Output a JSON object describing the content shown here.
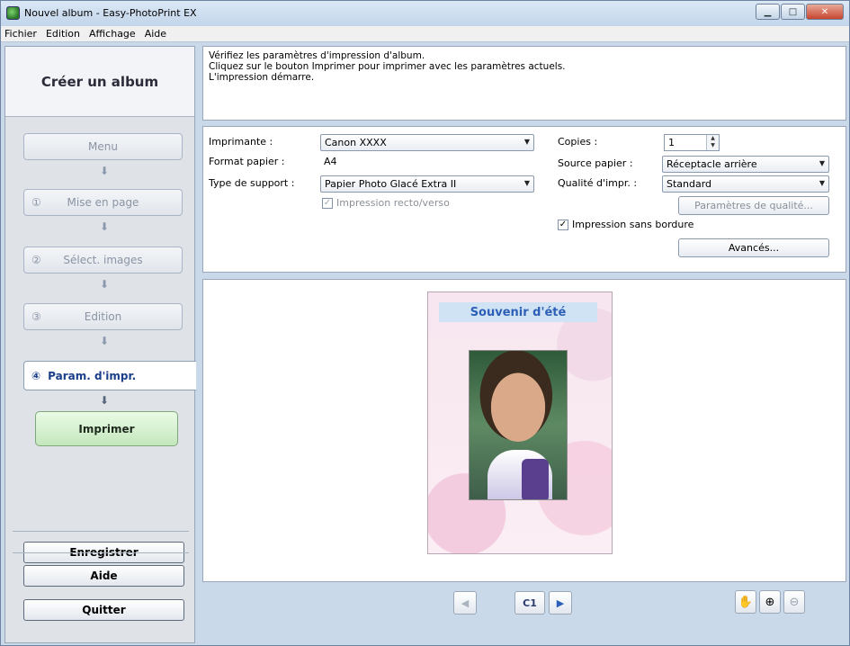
{
  "window": {
    "title": "Nouvel album - Easy-PhotoPrint EX",
    "min_icon": "minimize-icon",
    "max_icon": "maximize-icon",
    "close_icon": "close-icon"
  },
  "menu": {
    "items": [
      "Fichier",
      "Edition",
      "Affichage",
      "Aide"
    ]
  },
  "sidebar": {
    "title": "Créer un album",
    "steps": [
      {
        "num": "",
        "label": "Menu"
      },
      {
        "num": "①",
        "label": "Mise en page"
      },
      {
        "num": "②",
        "label": "Sélect. images"
      },
      {
        "num": "③",
        "label": "Edition"
      }
    ],
    "current_step": {
      "num": "④",
      "label": "Param. d'impr."
    },
    "print_label": "Imprimer",
    "save_label": "Enregistrer",
    "help_label": "Aide",
    "quit_label": "Quitter",
    "arrow_glyph": "⬇"
  },
  "info": {
    "line1": "Vérifiez les paramètres d'impression d'album.",
    "line2": "Cliquez sur le bouton Imprimer pour imprimer avec les paramètres actuels.",
    "line3": "L'impression démarre."
  },
  "settings": {
    "printer_label": "Imprimante :",
    "printer_value": "Canon XXXX",
    "paper_size_label": "Format papier :",
    "paper_size_value": "A4",
    "media_type_label": "Type de support :",
    "media_type_value": "Papier Photo Glacé Extra II",
    "duplex_label": "Impression recto/verso",
    "copies_label": "Copies :",
    "copies_value": "1",
    "paper_source_label": "Source papier :",
    "paper_source_value": "Réceptacle arrière",
    "quality_label": "Qualité d'impr. :",
    "quality_value": "Standard",
    "quality_settings_label": "Paramètres de qualité...",
    "borderless_label": "Impression sans bordure",
    "advanced_label": "Avancés...",
    "check_glyph": "✓",
    "dropdown_glyph": "▼"
  },
  "preview": {
    "album_title": "Souvenir d'été",
    "page_label": "C1",
    "prev_glyph": "◀",
    "next_glyph": "▶",
    "hand_glyph": "✋",
    "zoom_in_glyph": "⊕",
    "zoom_out_glyph": "⊖"
  }
}
